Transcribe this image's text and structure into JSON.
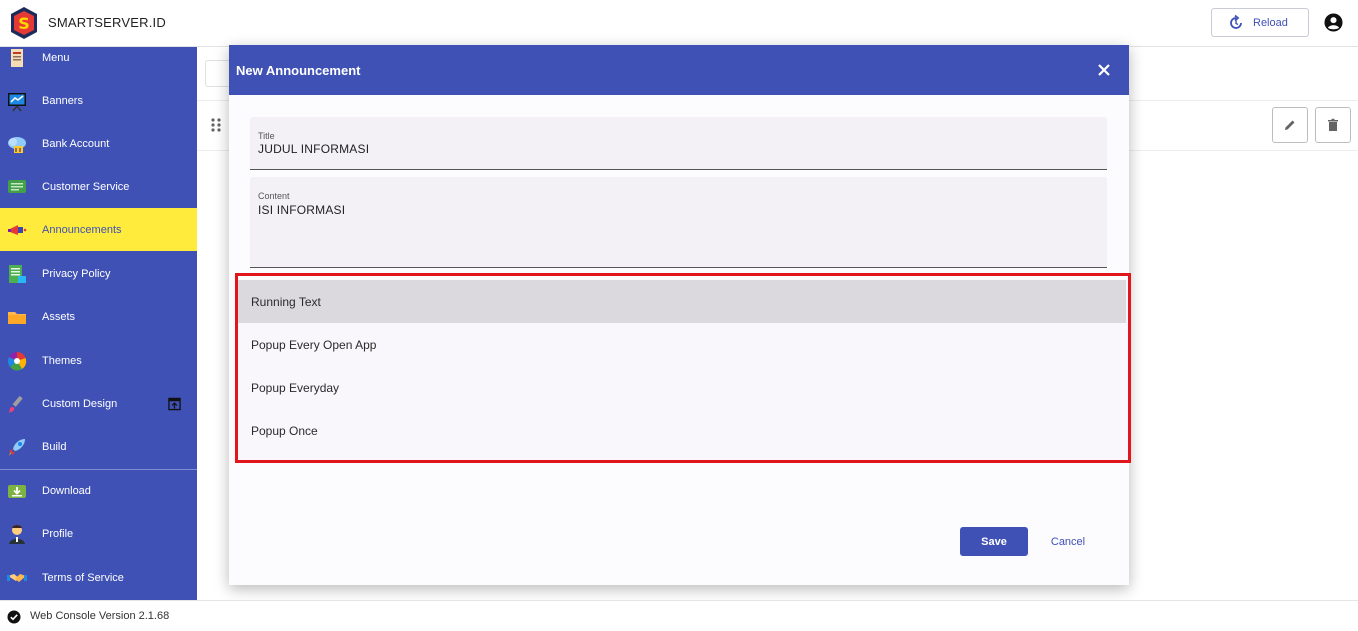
{
  "app": {
    "title": "SMARTSERVER.ID",
    "reload_label": "Reload"
  },
  "sidebar": {
    "items": [
      {
        "label": "Menu",
        "icon": "menu-book-icon"
      },
      {
        "label": "Banners",
        "icon": "presentation-icon"
      },
      {
        "label": "Bank Account",
        "icon": "cloud-bank-icon"
      },
      {
        "label": "Customer Service",
        "icon": "chat-icon"
      },
      {
        "label": "Announcements",
        "icon": "megaphone-icon",
        "active": true
      },
      {
        "label": "Privacy Policy",
        "icon": "document-icon"
      },
      {
        "label": "Assets",
        "icon": "folder-icon"
      },
      {
        "label": "Themes",
        "icon": "color-wheel-icon"
      },
      {
        "label": "Custom Design",
        "icon": "brush-icon"
      },
      {
        "label": "Build",
        "icon": "rocket-icon"
      },
      {
        "label": "Download",
        "icon": "download-icon"
      },
      {
        "label": "Profile",
        "icon": "user-icon"
      },
      {
        "label": "Terms of Service",
        "icon": "handshake-icon"
      }
    ]
  },
  "footer": {
    "version": "Web Console Version 2.1.68"
  },
  "dialog": {
    "title": "New Announcement",
    "title_field": {
      "label": "Title",
      "value": "JUDUL INFORMASI"
    },
    "content_field": {
      "label": "Content",
      "value": "ISI INFORMASI"
    },
    "type_options": [
      "Running Text",
      "Popup Every Open App",
      "Popup Everyday",
      "Popup Once"
    ],
    "selected_option": "Running Text",
    "save_label": "Save",
    "cancel_label": "Cancel"
  },
  "colors": {
    "primary": "#3f51b5",
    "active_nav": "#ffeb3b",
    "highlight": "#e0161c"
  }
}
